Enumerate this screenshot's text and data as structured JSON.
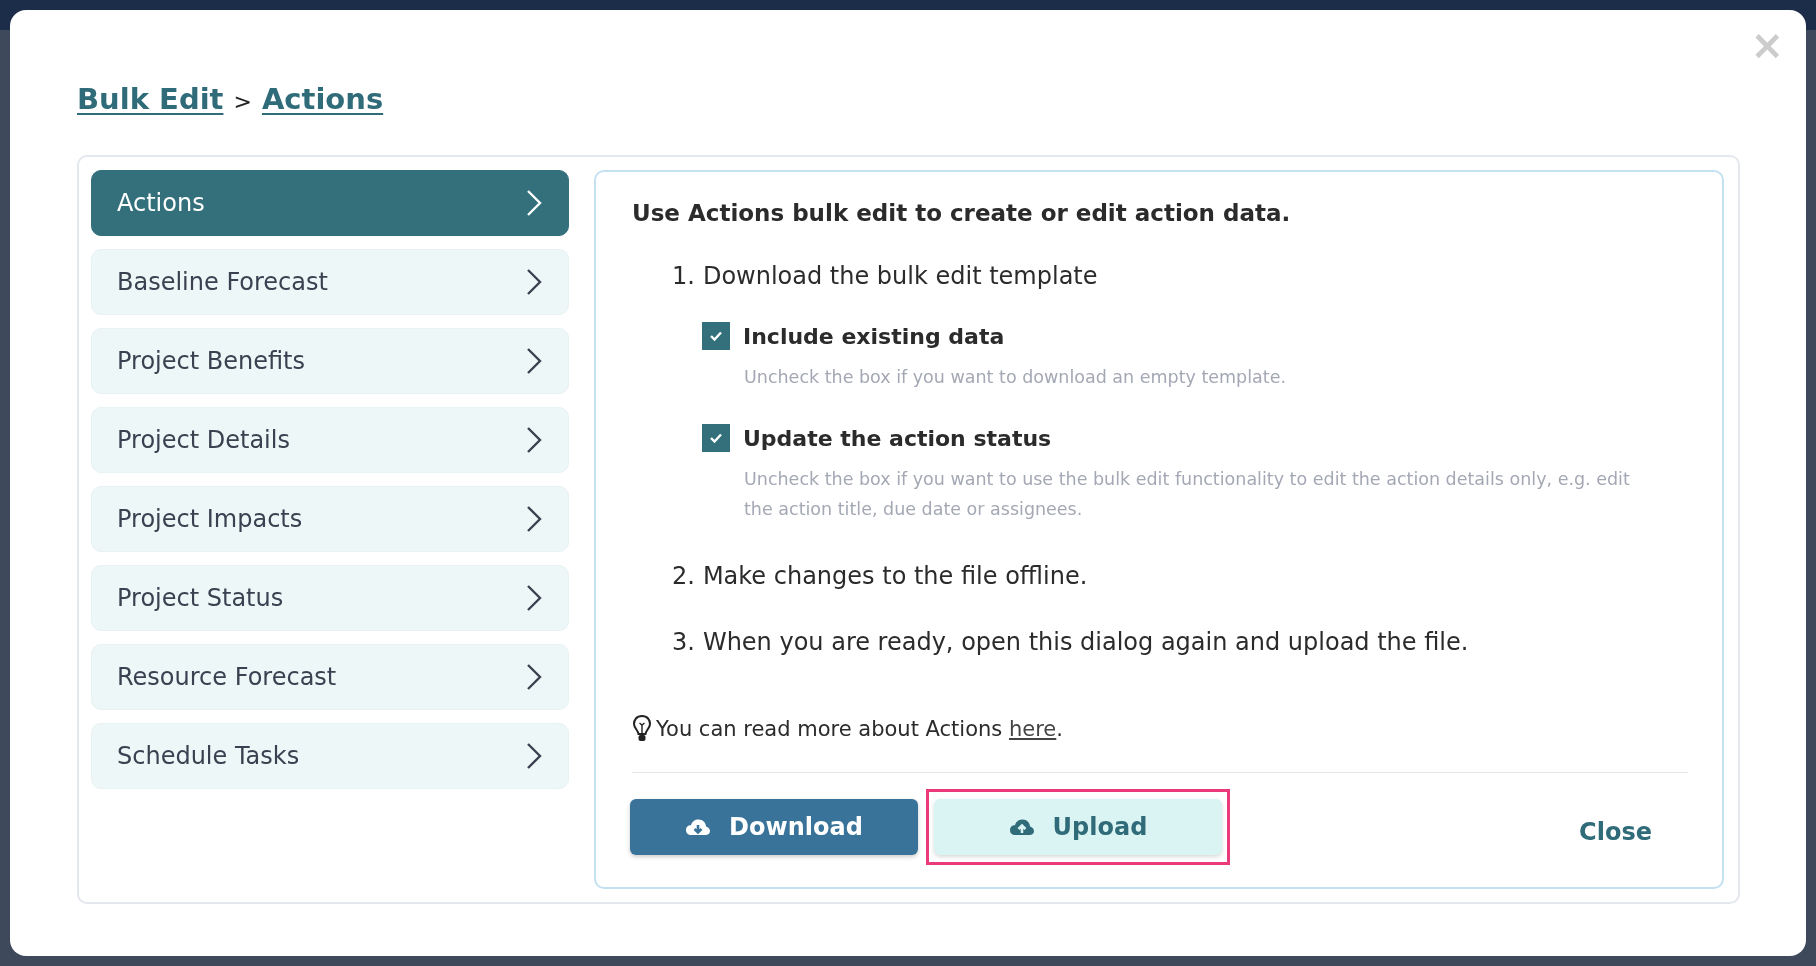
{
  "dialog": {
    "close_icon": "×",
    "breadcrumb": [
      {
        "label": "Bulk Edit"
      },
      {
        "separator": ">",
        "label": "Actions"
      }
    ],
    "sidebar": {
      "items": [
        {
          "label": "Actions",
          "selected": true
        },
        {
          "label": "Baseline Forecast",
          "selected": false
        },
        {
          "label": "Project Benefits",
          "selected": false
        },
        {
          "label": "Project Details",
          "selected": false
        },
        {
          "label": "Project Impacts",
          "selected": false
        },
        {
          "label": "Project Status",
          "selected": false
        },
        {
          "label": "Resource Forecast",
          "selected": false
        },
        {
          "label": "Schedule Tasks",
          "selected": false
        }
      ]
    },
    "content": {
      "heading": "Use Actions bulk edit to create or edit action data.",
      "steps": [
        {
          "number": "1.",
          "text": "Download the bulk edit template",
          "options": [
            {
              "label": "Include existing data",
              "checked": true,
              "hint": "Uncheck the box if you want to download an empty template."
            },
            {
              "label": "Update the action status",
              "checked": true,
              "hint": "Uncheck the box if you want to use the bulk edit functionality to edit the action details only, e.g. edit the action title, due date or assignees."
            }
          ]
        },
        {
          "number": "2.",
          "text": "Make changes to the file offline."
        },
        {
          "number": "3.",
          "text": "When you are ready, open this dialog again and upload the file."
        }
      ],
      "tip": {
        "text": "You can read more about Actions ",
        "link": "here",
        "after": "."
      },
      "buttons": [
        {
          "kind": "primary",
          "label": "Download",
          "highlighted": false
        },
        {
          "kind": "secondary",
          "label": "Upload",
          "highlighted": true
        },
        {
          "kind": "link",
          "label": "Close",
          "highlighted": false
        }
      ]
    }
  }
}
